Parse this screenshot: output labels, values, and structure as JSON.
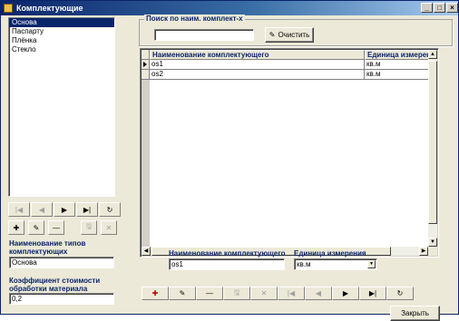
{
  "window": {
    "title": "Комплектующие",
    "controls": [
      "_",
      "□",
      "×"
    ]
  },
  "types_list": {
    "items": [
      "Основа",
      "Паспарту",
      "Плёнка",
      "Стекло"
    ],
    "selected_index": 0
  },
  "left_nav": {
    "first": "|◀",
    "prev": "◀",
    "next": "▶",
    "last": "▶|",
    "refresh": "↻",
    "add": "✚",
    "edit": "✎",
    "delete": "—",
    "save": "🖫",
    "cancel": "✕"
  },
  "type_name": {
    "label": "Наименование типов комплектующих",
    "value": "Основа"
  },
  "coef": {
    "label": "Коэффициент стоимости обработки материала",
    "value": "0,2"
  },
  "search": {
    "legend": "Поиск по наим. комплект-х",
    "value": "",
    "clear_label": "Очистить",
    "clear_icon": "broom-icon"
  },
  "grid": {
    "columns": [
      "Наименование комплектующего",
      "Единица измерения"
    ],
    "rows": [
      [
        "os1",
        "кв.м"
      ],
      [
        "os2",
        "кв.м"
      ]
    ],
    "current_row": 0
  },
  "detail": {
    "name_label": "Наименование комплектующего",
    "name_value": "os1",
    "unit_label": "Единица измерения",
    "unit_value": "кв.м"
  },
  "bottom_nav": {
    "add": "✚",
    "edit": "✎",
    "delete": "—",
    "save": "🖫",
    "cancel": "✕",
    "first": "|◀",
    "prev": "◀",
    "next": "▶",
    "last": "▶|",
    "refresh": "↻"
  },
  "close_button": "Закрыть"
}
